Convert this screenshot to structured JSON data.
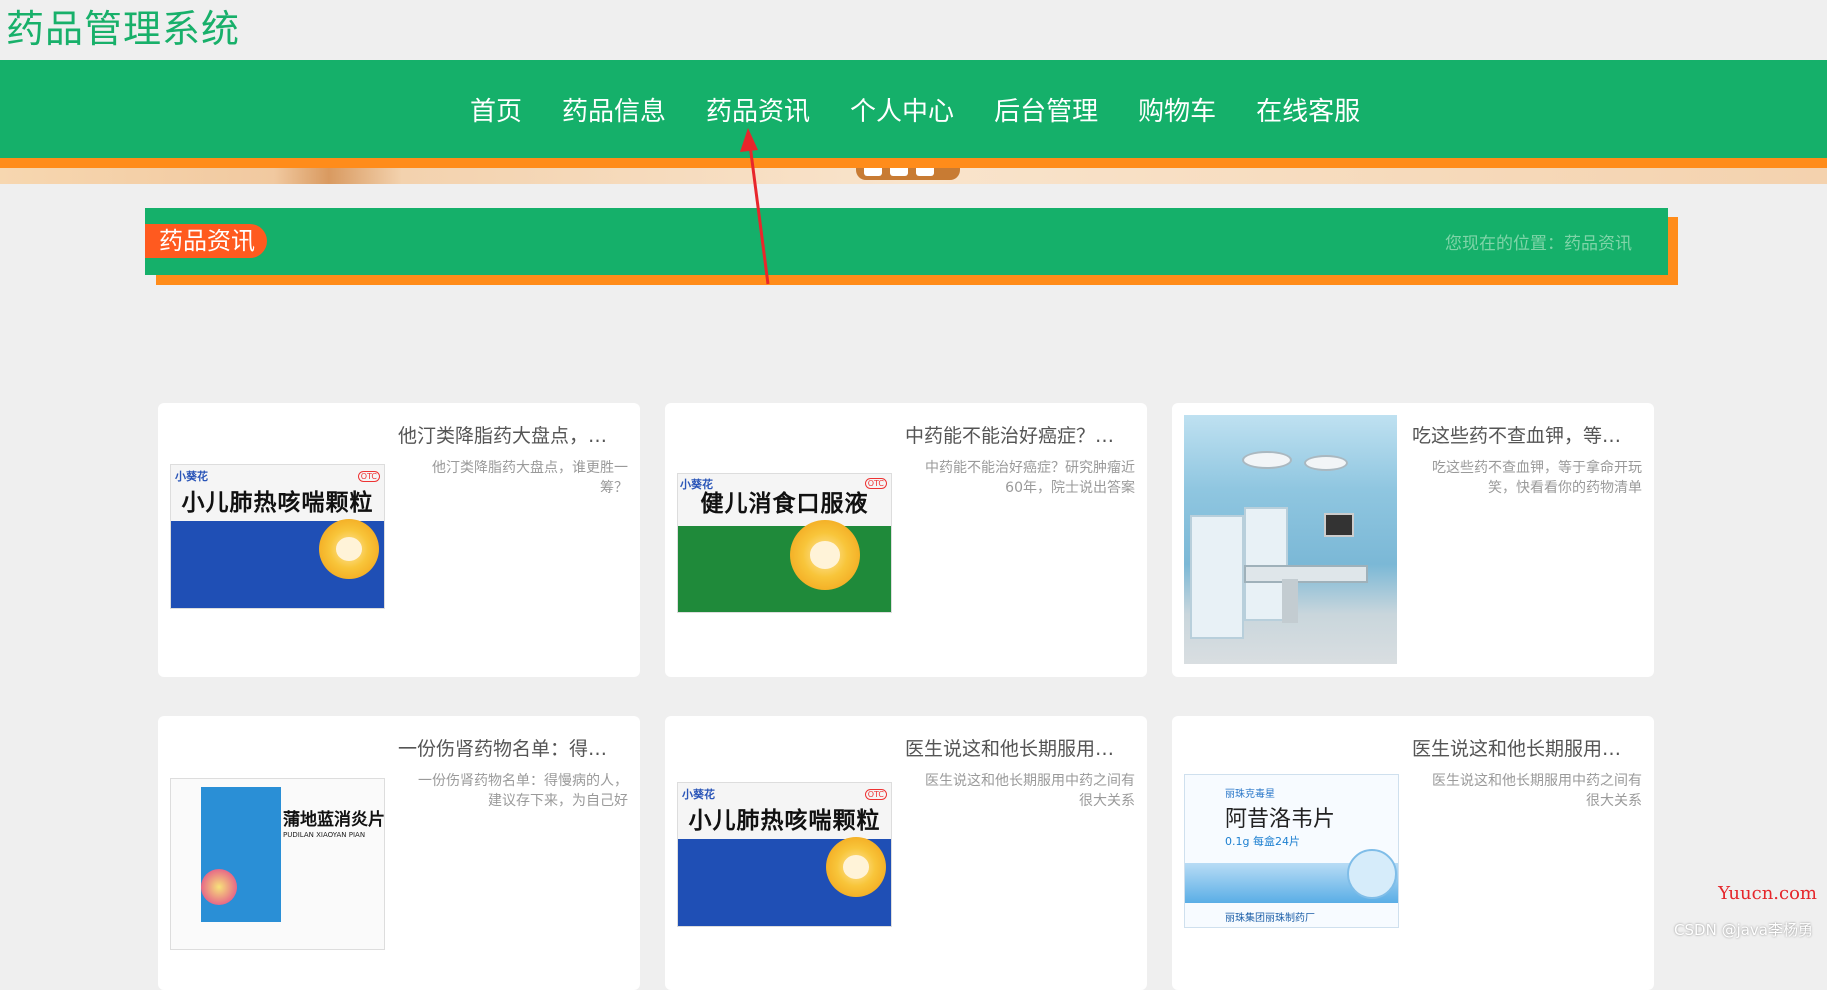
{
  "site": {
    "title": "药品管理系统"
  },
  "nav": {
    "items": [
      "首页",
      "药品信息",
      "药品资讯",
      "个人中心",
      "后台管理",
      "购物车",
      "在线客服"
    ]
  },
  "section": {
    "label": "药品资讯",
    "location": "您现在的位置：药品资讯"
  },
  "cards": [
    {
      "title": "他汀类降脂药大盘点，谁更胜一筹？",
      "desc": "他汀类降脂药大盘点，谁更胜一筹？",
      "image": "小儿肺热咳喘颗粒"
    },
    {
      "title": "中药能不能治好癌症？研究肿瘤近60年，院士说出答案",
      "desc": "中药能不能治好癌症？研究肿瘤近60年，院士说出答案",
      "image": "健儿消食口服液"
    },
    {
      "title": "吃这些药不查血钾，等于拿命开玩笑，快看看你的药物清单",
      "desc": "吃这些药不查血钾，等于拿命开玩笑，快看看你的药物清单",
      "image": "operating-room"
    },
    {
      "title": "一份伤肾药物名单：得慢病的人，建议存下来，为自己好",
      "desc": "一份伤肾药物名单：得慢病的人，建议存下来，为自己好",
      "image": "蒲地蓝消炎片"
    },
    {
      "title": "医生说这和他长期服用中药之间有很大关系",
      "desc": "医生说这和他长期服用中药之间有很大关系",
      "image": "小儿肺热咳喘颗粒"
    },
    {
      "title": "医生说这和他长期服用中药之间有很大关系",
      "desc": "医生说这和他长期服用中药之间有很大关系",
      "image": "阿昔洛韦片"
    }
  ],
  "thumbs": {
    "box1": {
      "brand": "小葵花",
      "name": "小儿肺热咳喘颗粒",
      "otc": "OTC"
    },
    "box2": {
      "brand": "小葵花",
      "name": "健儿消食口服液",
      "otc": "OTC"
    },
    "box4": {
      "name": "蒲地蓝消炎片",
      "pinyin": "PUDILAN XIAOYAN PIAN"
    },
    "box6": {
      "brand": "丽珠克毒星",
      "name": "阿昔洛韦片",
      "spec": "0.1g 每盒24片",
      "maker": "丽珠集团丽珠制药厂"
    }
  },
  "watermark": {
    "site": "Yuucn.com",
    "author": "CSDN @java李杨勇"
  },
  "colors": {
    "primary": "#15b06a",
    "accent": "#ff8c1a",
    "label": "#ff5a1f",
    "arrow": "#e8262b"
  }
}
